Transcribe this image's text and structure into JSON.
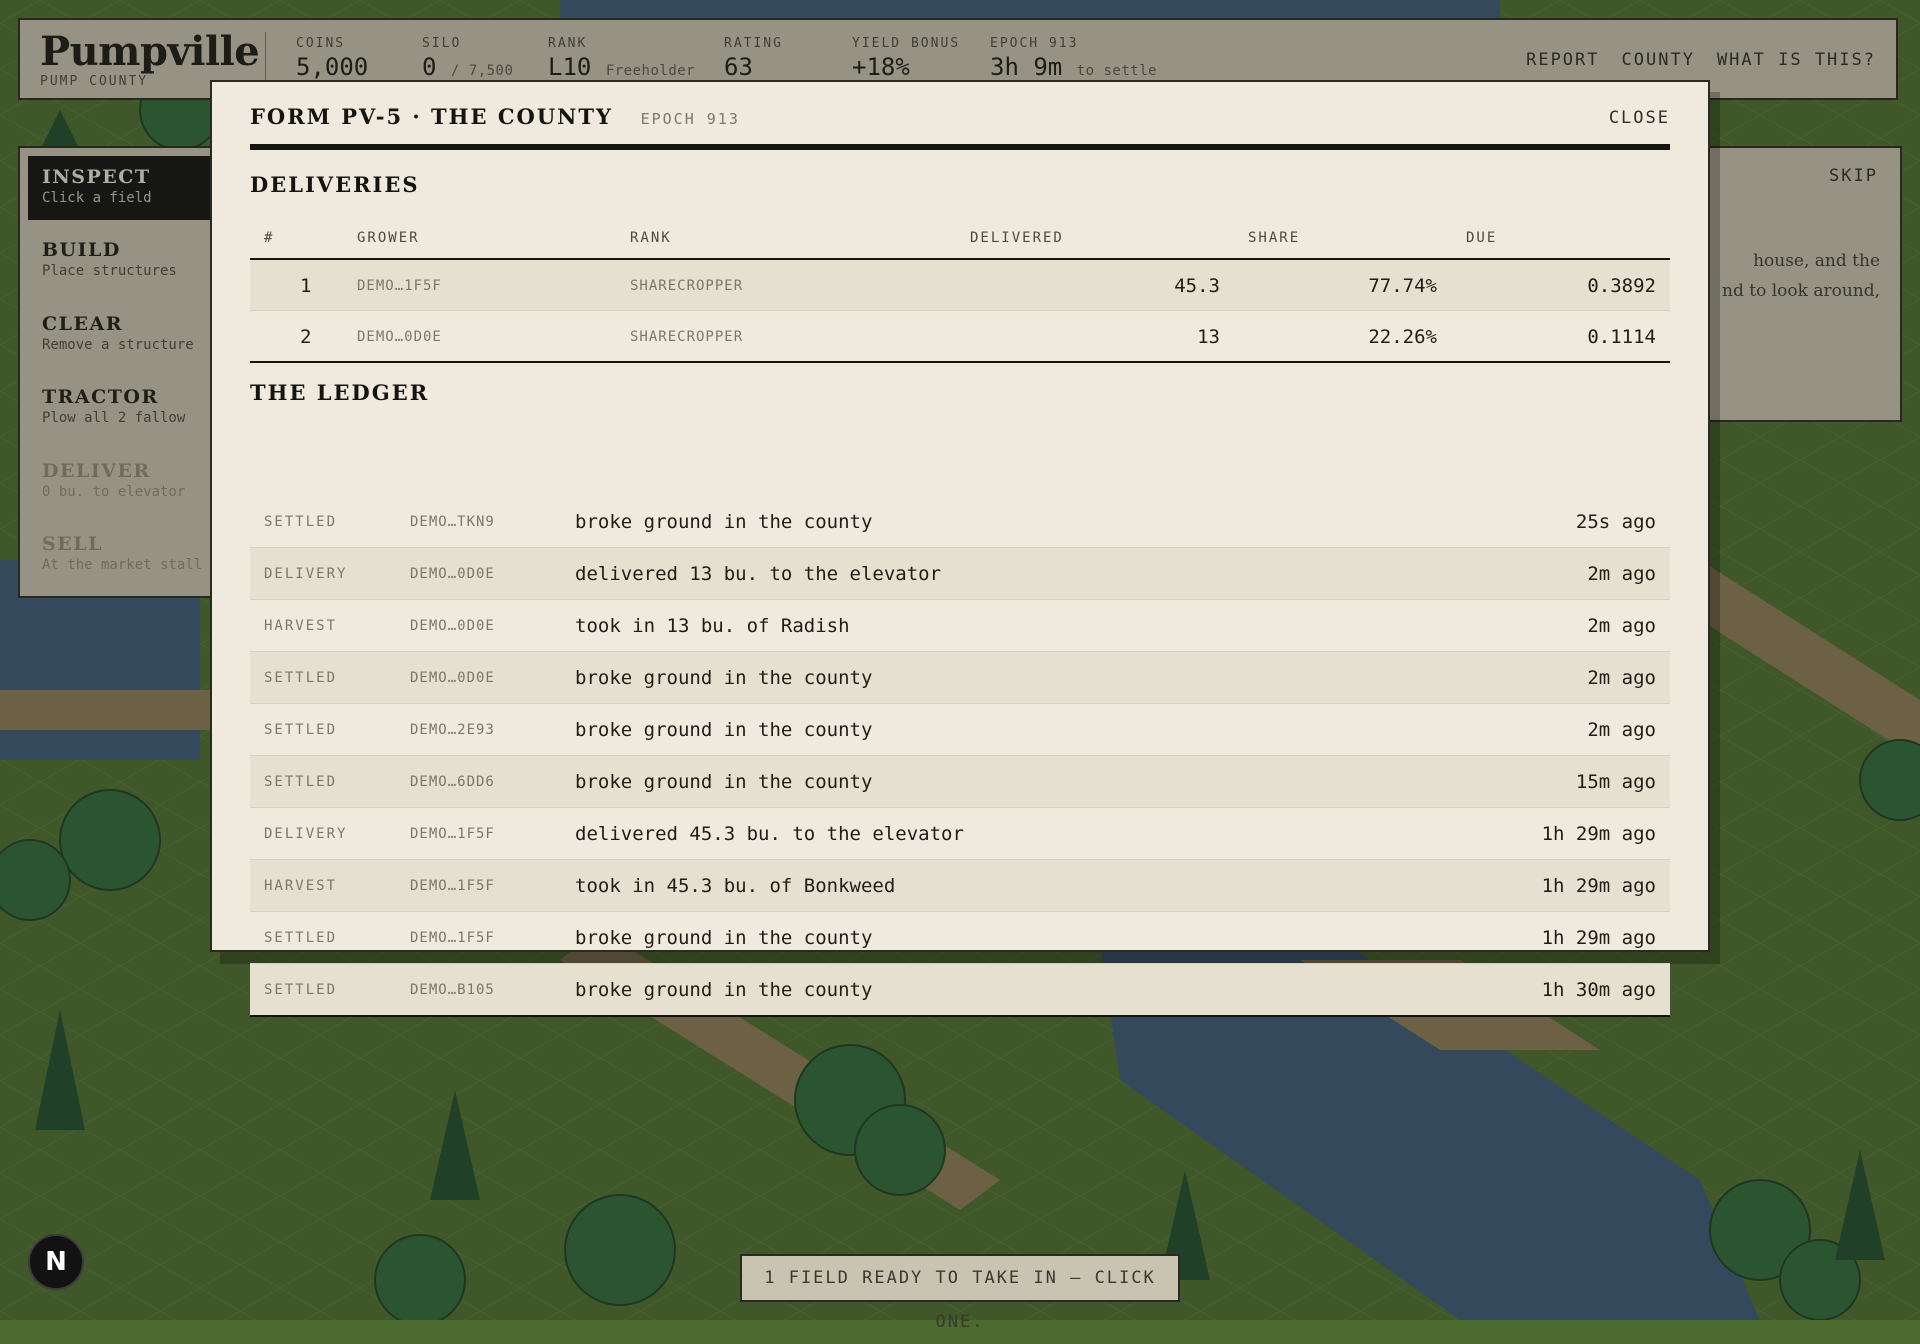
{
  "hud": {
    "title": "Pumpville",
    "subtitle": "PUMP COUNTY",
    "stats": [
      {
        "label": "COINS",
        "value": "5,000",
        "extra": ""
      },
      {
        "label": "SILO",
        "value": "0",
        "extra": "/ 7,500"
      },
      {
        "label": "RANK",
        "value": "L10",
        "extra": "Freeholder"
      },
      {
        "label": "RATING",
        "value": "63",
        "extra": ""
      },
      {
        "label": "YIELD BONUS",
        "value": "+18%",
        "extra": ""
      },
      {
        "label": "EPOCH 913",
        "value": "3h 9m",
        "extra": "to settle"
      }
    ],
    "nav": [
      "REPORT",
      "COUNTY",
      "WHAT IS THIS?"
    ]
  },
  "tools": [
    {
      "name": "INSPECT",
      "desc": "Click a field",
      "state": "active"
    },
    {
      "name": "BUILD",
      "desc": "Place structures",
      "state": "normal"
    },
    {
      "name": "CLEAR",
      "desc": "Remove a structure",
      "state": "normal"
    },
    {
      "name": "TRACTOR",
      "desc": "Plow all 2 fallow",
      "state": "normal"
    },
    {
      "name": "DELIVER",
      "desc": "0 bu. to elevator",
      "state": "disabled"
    },
    {
      "name": "SELL",
      "desc": "At the market stall",
      "state": "disabled"
    }
  ],
  "tutorial": {
    "skip_label": "SKIP",
    "line1": "house, and the",
    "line2": "nd to look around,"
  },
  "modal": {
    "title": "FORM PV-5 · THE COUNTY",
    "epoch": "EPOCH 913",
    "close_label": "CLOSE",
    "deliveries_title": "DELIVERIES",
    "deliveries_columns": [
      "#",
      "GROWER",
      "RANK",
      "DELIVERED",
      "SHARE",
      "DUE"
    ],
    "deliveries": [
      {
        "num": "1",
        "grower": "DEMO…1F5F",
        "rank": "SHARECROPPER",
        "delivered": "45.3",
        "share": "77.74%",
        "due": "0.3892"
      },
      {
        "num": "2",
        "grower": "DEMO…0D0E",
        "rank": "SHARECROPPER",
        "delivered": "13",
        "share": "22.26%",
        "due": "0.1114"
      }
    ],
    "ledger_title": "THE LEDGER",
    "ledger": [
      {
        "kind": "SETTLED",
        "user": "DEMO…TKN9",
        "text": "broke ground in the county",
        "time": "25s ago"
      },
      {
        "kind": "DELIVERY",
        "user": "DEMO…0D0E",
        "text": "delivered 13 bu. to the elevator",
        "time": "2m ago"
      },
      {
        "kind": "HARVEST",
        "user": "DEMO…0D0E",
        "text": "took in 13 bu. of Radish",
        "time": "2m ago"
      },
      {
        "kind": "SETTLED",
        "user": "DEMO…0D0E",
        "text": "broke ground in the county",
        "time": "2m ago"
      },
      {
        "kind": "SETTLED",
        "user": "DEMO…2E93",
        "text": "broke ground in the county",
        "time": "2m ago"
      },
      {
        "kind": "SETTLED",
        "user": "DEMO…6DD6",
        "text": "broke ground in the county",
        "time": "15m ago"
      },
      {
        "kind": "DELIVERY",
        "user": "DEMO…1F5F",
        "text": "delivered 45.3 bu. to the elevator",
        "time": "1h 29m ago"
      },
      {
        "kind": "HARVEST",
        "user": "DEMO…1F5F",
        "text": "took in 45.3 bu. of Bonkweed",
        "time": "1h 29m ago"
      },
      {
        "kind": "SETTLED",
        "user": "DEMO…1F5F",
        "text": "broke ground in the county",
        "time": "1h 29m ago"
      },
      {
        "kind": "SETTLED",
        "user": "DEMO…B105",
        "text": "broke ground in the county",
        "time": "1h 30m ago"
      }
    ]
  },
  "toast": "1 FIELD READY TO TAKE IN — CLICK ONE.",
  "badge": "N",
  "colors": {
    "grass": "#4a6a2e",
    "water": "#3a5878",
    "path": "#8a7a55",
    "panel": "#c9c3b1",
    "paper": "#efeadd",
    "ink": "#141410"
  }
}
